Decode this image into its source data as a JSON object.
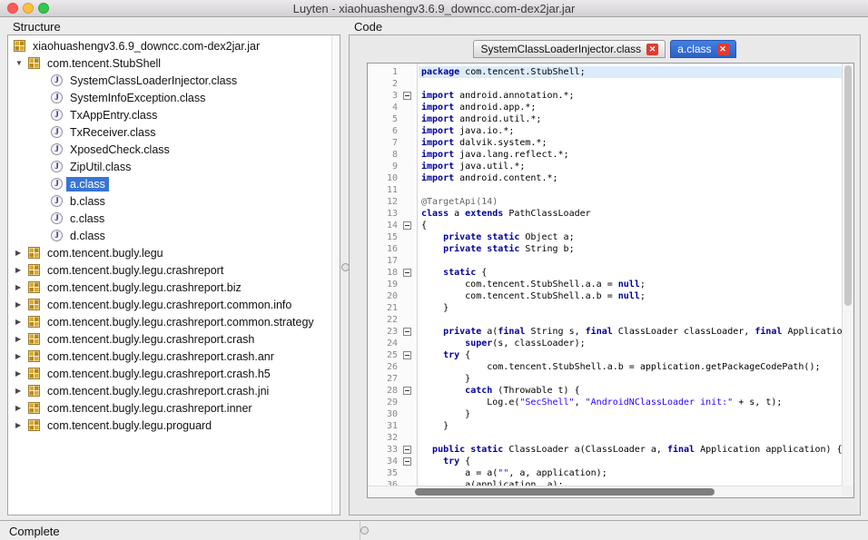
{
  "window": {
    "title": "Luyten - xiaohuashengv3.6.9_downcc.com-dex2jar.jar"
  },
  "colors": {
    "selection_blue": "#3875d6",
    "active_tab_blue": "#2e68d0",
    "tab_close_red": "#e13b30",
    "keyword": "#000099",
    "string": "#2a00ff",
    "annotation": "#646464",
    "current_line_highlight": "#dcecfb",
    "traffic_red": "#fc5b57",
    "traffic_yellow": "#fdbe41",
    "traffic_green": "#34c84a"
  },
  "structure": {
    "label": "Structure",
    "items": [
      {
        "label": "xiaohuashengv3.6.9_downcc.com-dex2jar.jar",
        "level": 0,
        "icon": "package",
        "arrow": "none",
        "selected": false
      },
      {
        "label": "com.tencent.StubShell",
        "level": 1,
        "icon": "package",
        "arrow": "expanded",
        "selected": false
      },
      {
        "label": "SystemClassLoaderInjector.class",
        "level": 2,
        "icon": "class",
        "arrow": "none",
        "selected": false
      },
      {
        "label": "SystemInfoException.class",
        "level": 2,
        "icon": "class",
        "arrow": "none",
        "selected": false
      },
      {
        "label": "TxAppEntry.class",
        "level": 2,
        "icon": "class",
        "arrow": "none",
        "selected": false
      },
      {
        "label": "TxReceiver.class",
        "level": 2,
        "icon": "class",
        "arrow": "none",
        "selected": false
      },
      {
        "label": "XposedCheck.class",
        "level": 2,
        "icon": "class",
        "arrow": "none",
        "selected": false
      },
      {
        "label": "ZipUtil.class",
        "level": 2,
        "icon": "class",
        "arrow": "none",
        "selected": false
      },
      {
        "label": "a.class",
        "level": 2,
        "icon": "class",
        "arrow": "none",
        "selected": true
      },
      {
        "label": "b.class",
        "level": 2,
        "icon": "class",
        "arrow": "none",
        "selected": false
      },
      {
        "label": "c.class",
        "level": 2,
        "icon": "class",
        "arrow": "none",
        "selected": false
      },
      {
        "label": "d.class",
        "level": 2,
        "icon": "class",
        "arrow": "none",
        "selected": false
      },
      {
        "label": "com.tencent.bugly.legu",
        "level": 1,
        "icon": "package",
        "arrow": "collapsed",
        "selected": false
      },
      {
        "label": "com.tencent.bugly.legu.crashreport",
        "level": 1,
        "icon": "package",
        "arrow": "collapsed",
        "selected": false
      },
      {
        "label": "com.tencent.bugly.legu.crashreport.biz",
        "level": 1,
        "icon": "package",
        "arrow": "collapsed",
        "selected": false
      },
      {
        "label": "com.tencent.bugly.legu.crashreport.common.info",
        "level": 1,
        "icon": "package",
        "arrow": "collapsed",
        "selected": false
      },
      {
        "label": "com.tencent.bugly.legu.crashreport.common.strategy",
        "level": 1,
        "icon": "package",
        "arrow": "collapsed",
        "selected": false
      },
      {
        "label": "com.tencent.bugly.legu.crashreport.crash",
        "level": 1,
        "icon": "package",
        "arrow": "collapsed",
        "selected": false
      },
      {
        "label": "com.tencent.bugly.legu.crashreport.crash.anr",
        "level": 1,
        "icon": "package",
        "arrow": "collapsed",
        "selected": false
      },
      {
        "label": "com.tencent.bugly.legu.crashreport.crash.h5",
        "level": 1,
        "icon": "package",
        "arrow": "collapsed",
        "selected": false
      },
      {
        "label": "com.tencent.bugly.legu.crashreport.crash.jni",
        "level": 1,
        "icon": "package",
        "arrow": "collapsed",
        "selected": false
      },
      {
        "label": "com.tencent.bugly.legu.crashreport.inner",
        "level": 1,
        "icon": "package",
        "arrow": "collapsed",
        "selected": false
      },
      {
        "label": "com.tencent.bugly.legu.proguard",
        "level": 1,
        "icon": "package",
        "arrow": "collapsed",
        "selected": false
      }
    ]
  },
  "code": {
    "label": "Code",
    "tabs": [
      {
        "label": "SystemClassLoaderInjector.class",
        "active": false
      },
      {
        "label": "a.class",
        "active": true
      }
    ],
    "lines": [
      {
        "n": 1,
        "hl": true,
        "segs": [
          [
            "k",
            "package"
          ],
          [
            "p",
            " com.tencent.StubShell;"
          ]
        ]
      },
      {
        "n": 2,
        "segs": []
      },
      {
        "n": 3,
        "fold": true,
        "segs": [
          [
            "k",
            "import"
          ],
          [
            "p",
            " android.annotation.*;"
          ]
        ]
      },
      {
        "n": 4,
        "segs": [
          [
            "k",
            "import"
          ],
          [
            "p",
            " android.app.*;"
          ]
        ]
      },
      {
        "n": 5,
        "segs": [
          [
            "k",
            "import"
          ],
          [
            "p",
            " android.util.*;"
          ]
        ]
      },
      {
        "n": 6,
        "segs": [
          [
            "k",
            "import"
          ],
          [
            "p",
            " java.io.*;"
          ]
        ]
      },
      {
        "n": 7,
        "segs": [
          [
            "k",
            "import"
          ],
          [
            "p",
            " dalvik.system.*;"
          ]
        ]
      },
      {
        "n": 8,
        "segs": [
          [
            "k",
            "import"
          ],
          [
            "p",
            " java.lang.reflect.*;"
          ]
        ]
      },
      {
        "n": 9,
        "segs": [
          [
            "k",
            "import"
          ],
          [
            "p",
            " java.util.*;"
          ]
        ]
      },
      {
        "n": 10,
        "segs": [
          [
            "k",
            "import"
          ],
          [
            "p",
            " android.content.*;"
          ]
        ]
      },
      {
        "n": 11,
        "segs": []
      },
      {
        "n": 12,
        "segs": [
          [
            "a",
            "@TargetApi(14)"
          ]
        ]
      },
      {
        "n": 13,
        "segs": [
          [
            "k",
            "class"
          ],
          [
            "p",
            " a "
          ],
          [
            "k",
            "extends"
          ],
          [
            "p",
            " PathClassLoader"
          ]
        ]
      },
      {
        "n": 14,
        "fold": true,
        "segs": [
          [
            "p",
            "{"
          ]
        ]
      },
      {
        "n": 15,
        "segs": [
          [
            "p",
            "    "
          ],
          [
            "k",
            "private static"
          ],
          [
            "p",
            " Object a;"
          ]
        ]
      },
      {
        "n": 16,
        "segs": [
          [
            "p",
            "    "
          ],
          [
            "k",
            "private static"
          ],
          [
            "p",
            " String b;"
          ]
        ]
      },
      {
        "n": 17,
        "segs": []
      },
      {
        "n": 18,
        "fold": true,
        "segs": [
          [
            "p",
            "    "
          ],
          [
            "k",
            "static"
          ],
          [
            "p",
            " {"
          ]
        ]
      },
      {
        "n": 19,
        "segs": [
          [
            "p",
            "        com.tencent.StubShell.a.a = "
          ],
          [
            "k",
            "null"
          ],
          [
            "p",
            ";"
          ]
        ]
      },
      {
        "n": 20,
        "segs": [
          [
            "p",
            "        com.tencent.StubShell.a.b = "
          ],
          [
            "k",
            "null"
          ],
          [
            "p",
            ";"
          ]
        ]
      },
      {
        "n": 21,
        "segs": [
          [
            "p",
            "    }"
          ]
        ]
      },
      {
        "n": 22,
        "segs": []
      },
      {
        "n": 23,
        "fold": true,
        "segs": [
          [
            "p",
            "    "
          ],
          [
            "k",
            "private"
          ],
          [
            "p",
            " a("
          ],
          [
            "k",
            "final"
          ],
          [
            "p",
            " String s, "
          ],
          [
            "k",
            "final"
          ],
          [
            "p",
            " ClassLoader classLoader, "
          ],
          [
            "k",
            "final"
          ],
          [
            "p",
            " Application application) {"
          ]
        ]
      },
      {
        "n": 24,
        "segs": [
          [
            "p",
            "        "
          ],
          [
            "k",
            "super"
          ],
          [
            "p",
            "(s, classLoader);"
          ]
        ]
      },
      {
        "n": 25,
        "fold": true,
        "segs": [
          [
            "p",
            "    "
          ],
          [
            "k",
            "try"
          ],
          [
            "p",
            " {"
          ]
        ]
      },
      {
        "n": 26,
        "segs": [
          [
            "p",
            "            com.tencent.StubShell.a.b = application.getPackageCodePath();"
          ]
        ]
      },
      {
        "n": 27,
        "segs": [
          [
            "p",
            "        }"
          ]
        ]
      },
      {
        "n": 28,
        "fold": true,
        "segs": [
          [
            "p",
            "        "
          ],
          [
            "k",
            "catch"
          ],
          [
            "p",
            " (Throwable t) {"
          ]
        ]
      },
      {
        "n": 29,
        "segs": [
          [
            "p",
            "            Log.e("
          ],
          [
            "s",
            "\"SecShell\""
          ],
          [
            "p",
            ", "
          ],
          [
            "s",
            "\"AndroidNClassLoader init:\""
          ],
          [
            "p",
            " + s, t);"
          ]
        ]
      },
      {
        "n": 30,
        "segs": [
          [
            "p",
            "        }"
          ]
        ]
      },
      {
        "n": 31,
        "segs": [
          [
            "p",
            "    }"
          ]
        ]
      },
      {
        "n": 32,
        "segs": []
      },
      {
        "n": 33,
        "fold": true,
        "segs": [
          [
            "p",
            "  "
          ],
          [
            "k",
            "public static"
          ],
          [
            "p",
            " ClassLoader a(ClassLoader a, "
          ],
          [
            "k",
            "final"
          ],
          [
            "p",
            " Application application) {"
          ]
        ]
      },
      {
        "n": 34,
        "fold": true,
        "segs": [
          [
            "p",
            "    "
          ],
          [
            "k",
            "try"
          ],
          [
            "p",
            " {"
          ]
        ]
      },
      {
        "n": 35,
        "segs": [
          [
            "p",
            "        a = a("
          ],
          [
            "s",
            "\"\""
          ],
          [
            "p",
            ", a, application);"
          ]
        ]
      },
      {
        "n": 36,
        "segs": [
          [
            "p",
            "        a(application, a);"
          ]
        ]
      }
    ]
  },
  "status": {
    "text": "Complete"
  }
}
